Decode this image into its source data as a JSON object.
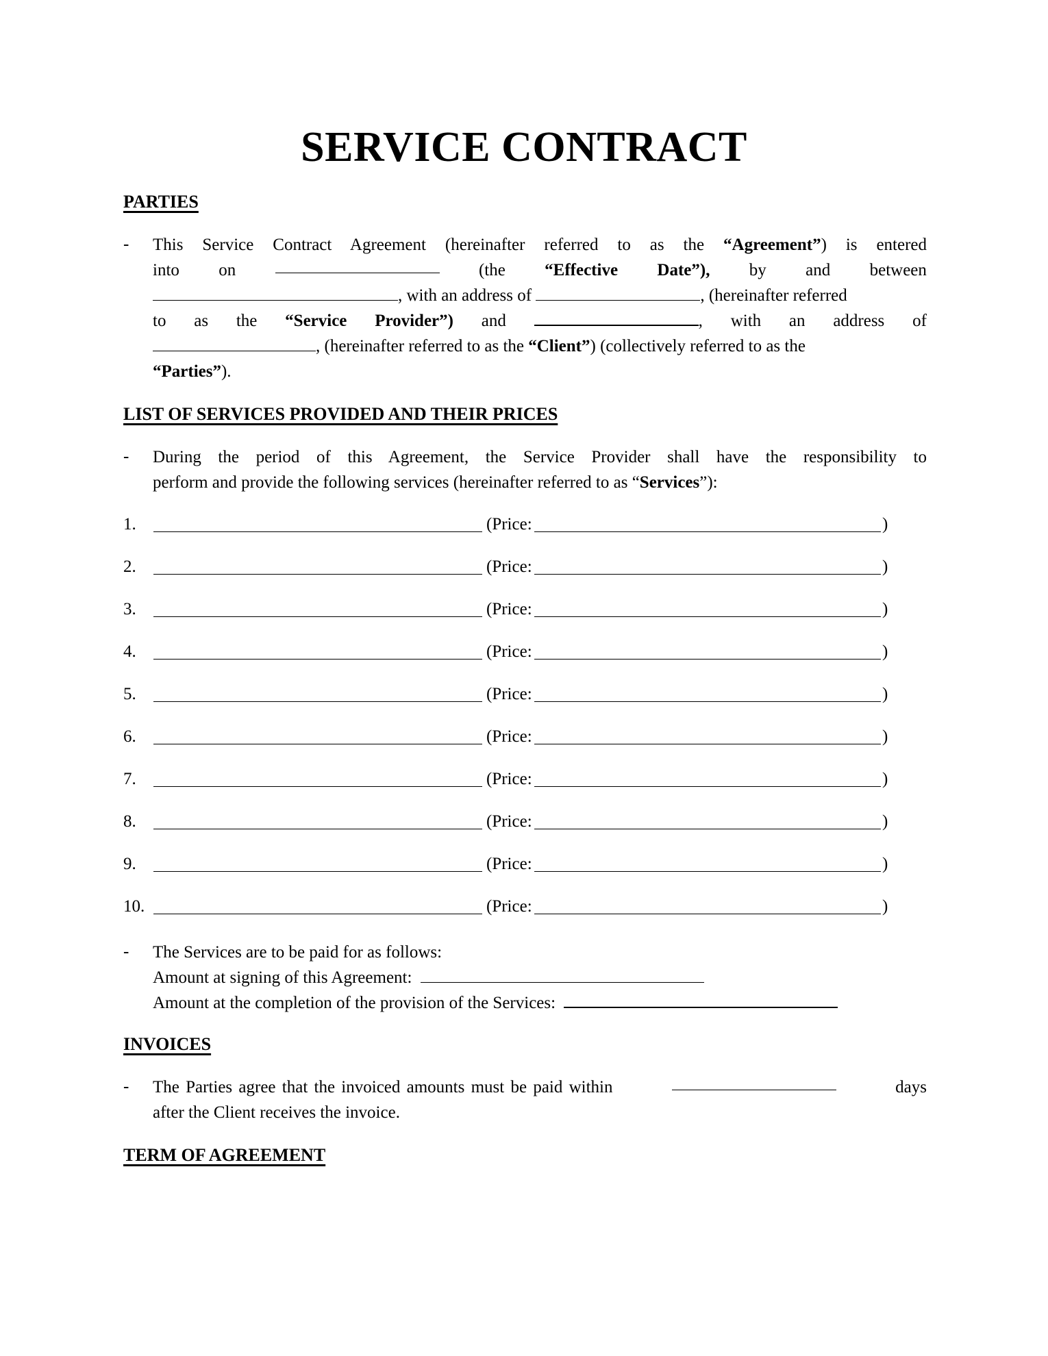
{
  "document": {
    "title": "SERVICE CONTRACT",
    "sections": {
      "parties": {
        "heading": "PARTIES",
        "dash": "-",
        "line1": {
          "pre": "This Service Contract Agreement (hereinafter referred to as the ",
          "bold": "“Agreement”",
          "post": ") is entered"
        },
        "line2": {
          "w1": "into",
          "w2": "on",
          "w3": "(the",
          "bold1": "“Effective",
          "bold2": "Date”),",
          "w4": "by",
          "w5": "and",
          "w6": "between"
        },
        "line3": {
          "a": ", with an address of ",
          "b": ", (hereinafter referred"
        },
        "line4": {
          "w1": "to",
          "w2": "as",
          "w3": "the",
          "bold1": "“Service",
          "bold2": "Provider”)",
          "w4": "and",
          "w5": ",",
          "w6": "with",
          "w7": "an",
          "w8": "address",
          "w9": "of"
        },
        "line5": {
          "a": ", (hereinafter referred to as the ",
          "bold": "“Client”",
          "b": ") (collectively referred to as the"
        },
        "line6": {
          "bold": "“Parties”",
          "post": ")."
        }
      },
      "services": {
        "heading": "LIST OF SERVICES PROVIDED AND THEIR PRICES",
        "dash": "-",
        "intro_line1": "During the period of this Agreement, the Service Provider shall have the responsibility to",
        "intro_line2": {
          "pre": "perform and provide the following services (hereinafter referred to as “",
          "bold": "Services",
          "post": "”):"
        },
        "items": [
          {
            "num": "1.",
            "price_label": "(Price:",
            "close": ")"
          },
          {
            "num": "2.",
            "price_label": "(Price:",
            "close": ")"
          },
          {
            "num": "3.",
            "price_label": "(Price:",
            "close": ")"
          },
          {
            "num": "4.",
            "price_label": "(Price:",
            "close": ")"
          },
          {
            "num": "5.",
            "price_label": "(Price:",
            "close": ")"
          },
          {
            "num": "6.",
            "price_label": "(Price:",
            "close": ")"
          },
          {
            "num": "7.",
            "price_label": "(Price:",
            "close": ")"
          },
          {
            "num": "8.",
            "price_label": "(Price:",
            "close": ")"
          },
          {
            "num": "9.",
            "price_label": "(Price:",
            "close": ")"
          },
          {
            "num": "10.",
            "price_label": "(Price:",
            "close": ")"
          }
        ],
        "payment_intro": "The Services are to be paid for as follows:",
        "amount_signing": "Amount at signing of this Agreement:",
        "amount_completion": "Amount at the completion of the provision of the Services:"
      },
      "invoices": {
        "heading": "INVOICES",
        "dash": "-",
        "line1": {
          "pre": "The Parties agree that the invoiced amounts must be paid within",
          "post": "days"
        },
        "line2": "after the Client receives the invoice."
      },
      "term": {
        "heading": "TERM OF AGREEMENT"
      }
    }
  }
}
